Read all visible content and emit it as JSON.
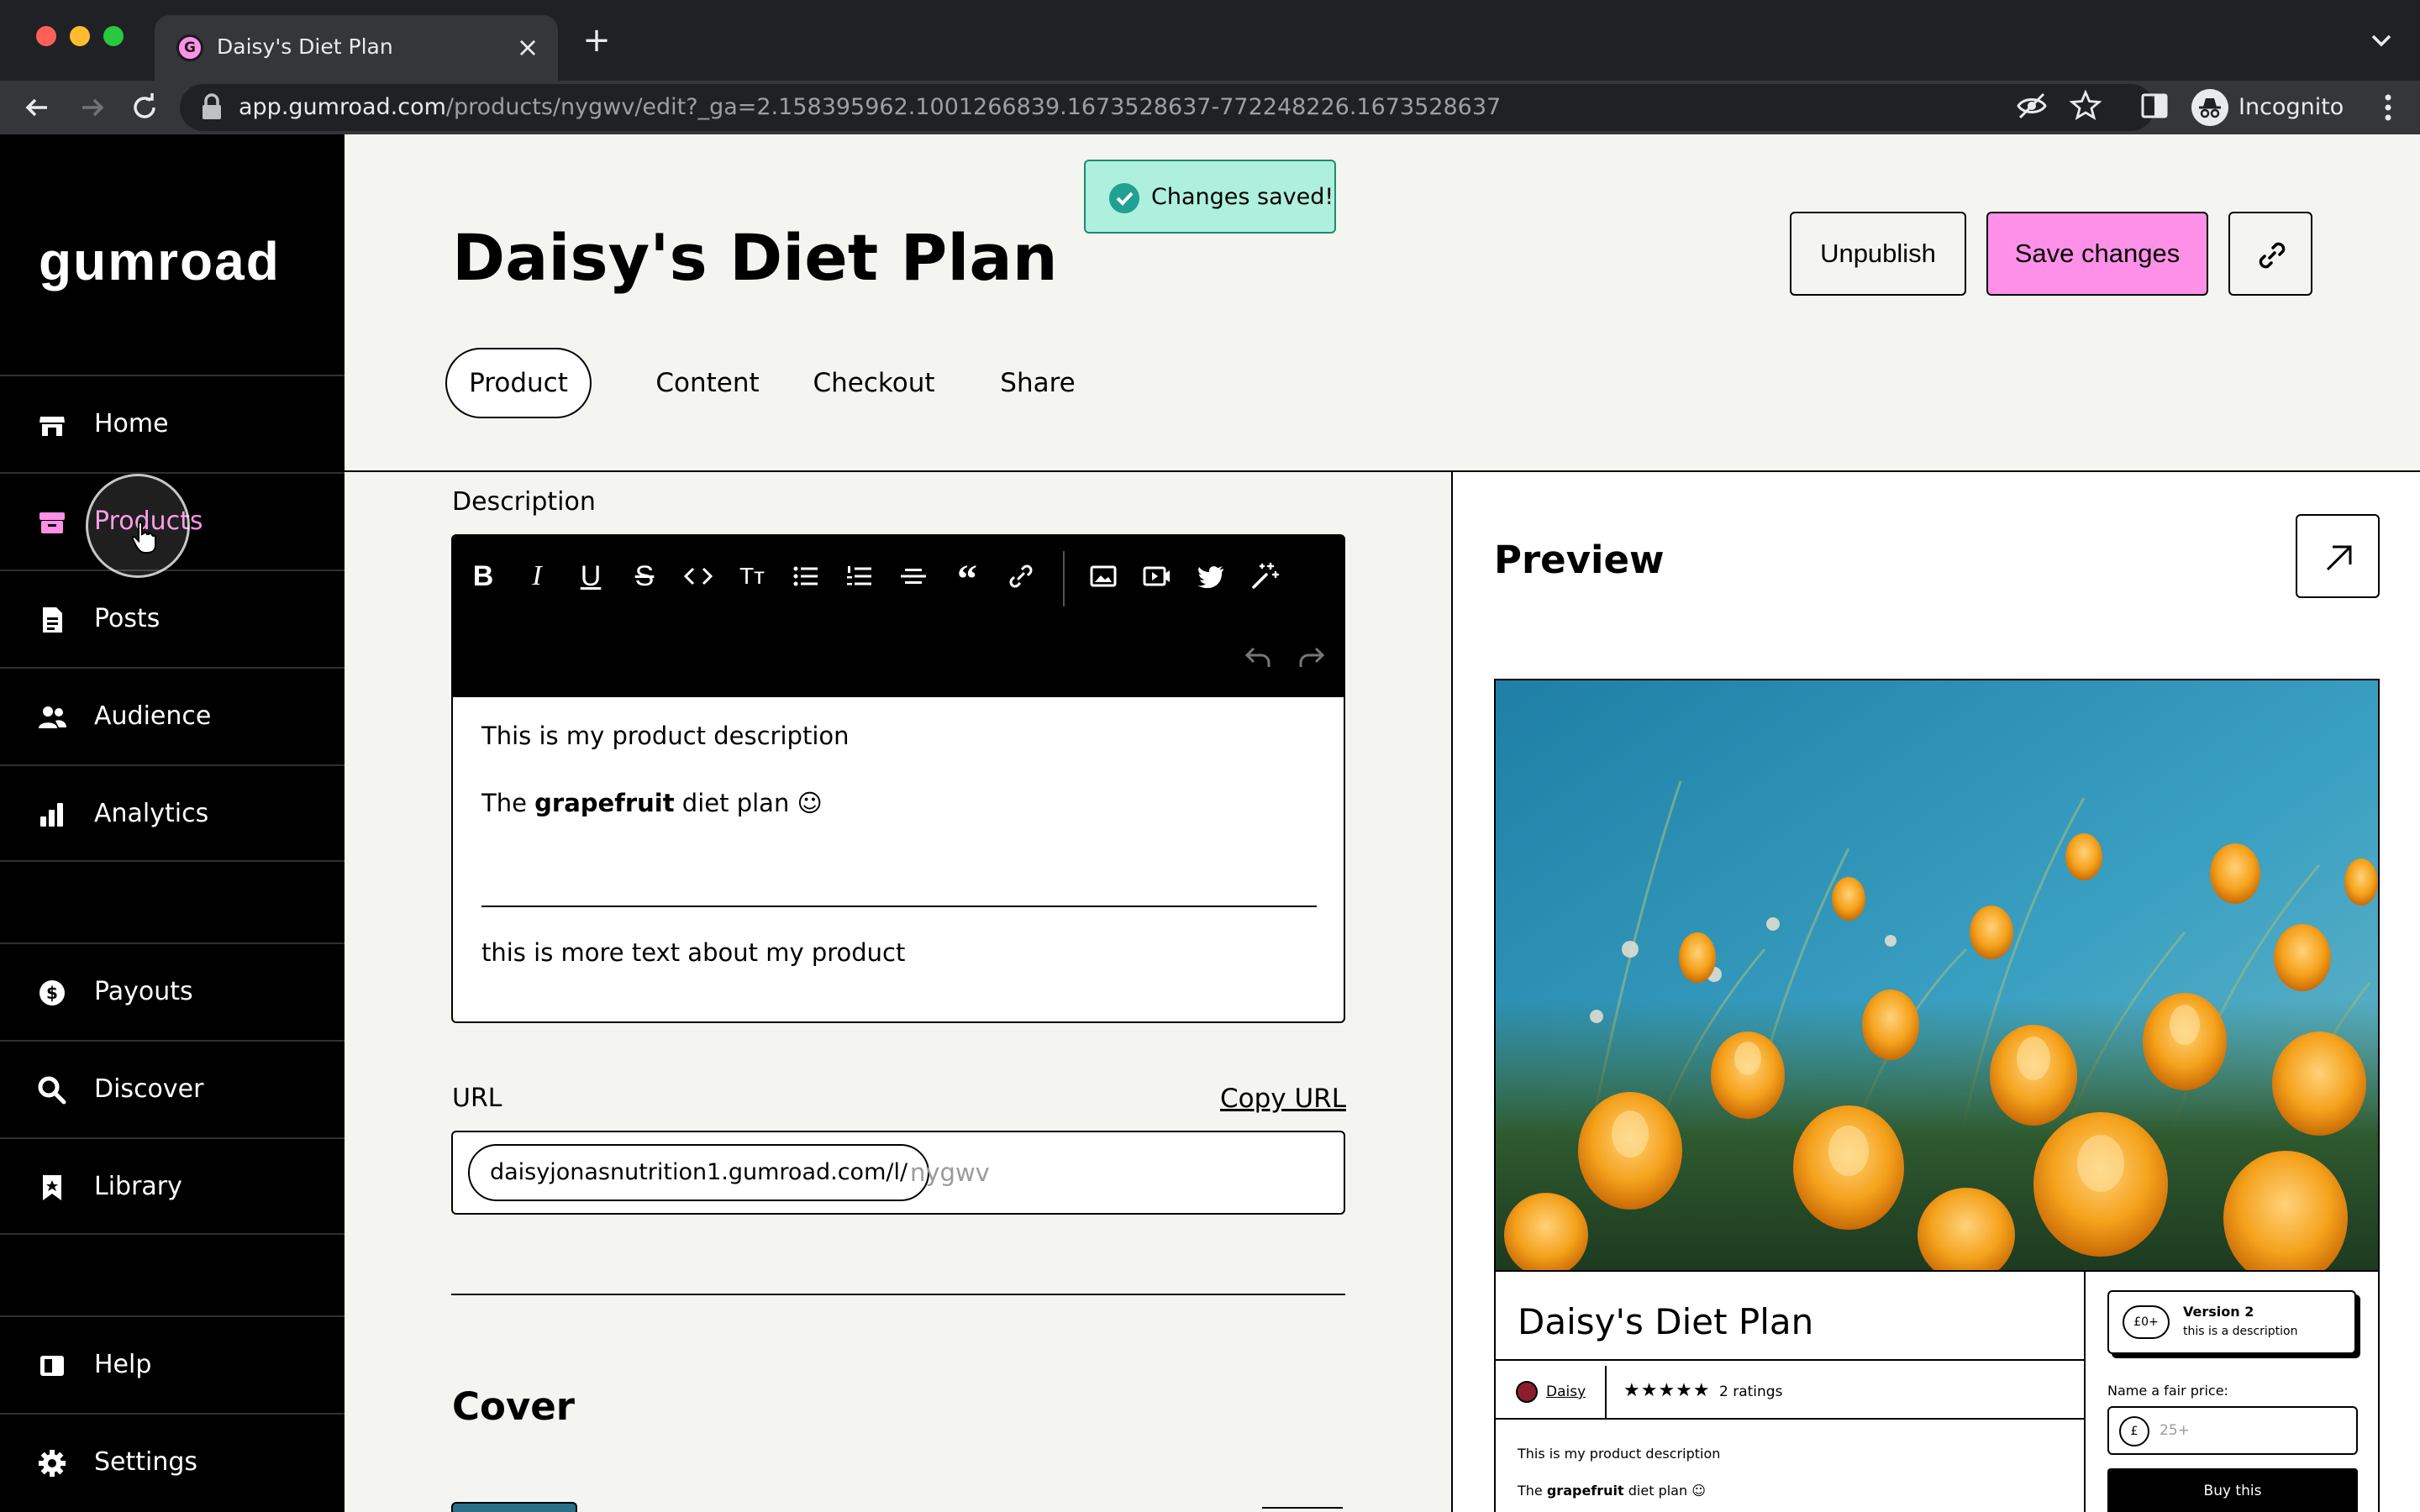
{
  "browser": {
    "tab_title": "Daisy's Diet Plan",
    "tab_favicon_letter": "G",
    "url_host": "app.gumroad.com",
    "url_path": "/products/nygwv/edit?_ga=2.158395962.1001266839.1673528637-772248226.1673528637",
    "profile_label": "Incognito"
  },
  "sidebar": {
    "logo": "Gumroad",
    "items": [
      {
        "label": "Home",
        "icon": "store-icon"
      },
      {
        "label": "Products",
        "icon": "archive-box-icon",
        "active": true
      },
      {
        "label": "Posts",
        "icon": "document-icon"
      },
      {
        "label": "Audience",
        "icon": "users-icon"
      },
      {
        "label": "Analytics",
        "icon": "bar-chart-icon"
      },
      {
        "label": "Payouts",
        "icon": "dollar-circle-icon"
      },
      {
        "label": "Discover",
        "icon": "search-icon"
      },
      {
        "label": "Library",
        "icon": "bookmark-icon"
      },
      {
        "label": "Help",
        "icon": "book-icon"
      },
      {
        "label": "Settings",
        "icon": "gear-icon"
      }
    ]
  },
  "header": {
    "title": "Daisy's Diet Plan",
    "toast": "Changes saved!",
    "unpublish_label": "Unpublish",
    "save_label": "Save changes",
    "tabs": [
      "Product",
      "Content",
      "Checkout",
      "Share"
    ],
    "active_tab": "Product"
  },
  "editor": {
    "description_label": "Description",
    "line1": "This is my product description",
    "line2_prefix": "The ",
    "line2_bold": "grapefruit",
    "line2_suffix": " diet plan ☺",
    "line3": "this is more text about my product",
    "url_label": "URL",
    "copy_url_label": "Copy URL",
    "url_prefix": "daisyjonasnutrition1.gumroad.com/l/",
    "url_placeholder": "nygwv",
    "cover_title": "Cover"
  },
  "preview": {
    "title": "Preview",
    "product_name": "Daisy's Diet Plan",
    "author": "Daisy",
    "stars": "★★★★★",
    "ratings": "2 ratings",
    "desc_line1": "This is my product description",
    "desc_line2_prefix": "The ",
    "desc_line2_bold": "grapefruit",
    "desc_line2_suffix": " diet plan ☺",
    "version_price": "£0+",
    "version_name": "Version 2",
    "version_desc": "this is a description",
    "fair_price_label": "Name a fair price:",
    "currency": "£",
    "price_placeholder": "25+",
    "buy_label": "Buy this"
  },
  "colors": {
    "accent_pink": "#ff90e8",
    "sidebar_bg": "#000000",
    "page_bg": "#f4f4f0",
    "toast_bg": "#aef0dd",
    "toast_check": "#23a094"
  }
}
